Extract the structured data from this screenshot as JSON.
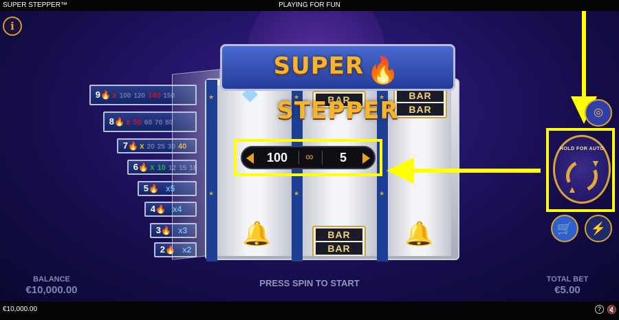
{
  "topbar": {
    "game_title": "SUPER STEPPER™",
    "mode": "PLAYING FOR FUN"
  },
  "logo": {
    "left": "SUPER",
    "right": "STEPPER"
  },
  "paytable": [
    {
      "count": "9",
      "multiplier": "x",
      "values": [
        "100",
        "120",
        "140",
        "150"
      ],
      "highlight_index": 2,
      "color": "#c0182a"
    },
    {
      "count": "8",
      "multiplier": "x",
      "values": [
        "50",
        "60",
        "70",
        "80"
      ],
      "highlight_index": 0,
      "color": "#c0182a"
    },
    {
      "count": "7",
      "multiplier": "x",
      "values": [
        "20",
        "25",
        "30",
        "40"
      ],
      "highlight_index": 3,
      "color": "#e8b020"
    },
    {
      "count": "6",
      "multiplier": "x",
      "values": [
        "10",
        "12",
        "15",
        "18"
      ],
      "highlight_index": 0,
      "color": "#28b040"
    },
    {
      "count": "5",
      "multiplier": "x5",
      "values": [],
      "color": "#5fb0ff"
    },
    {
      "count": "4",
      "multiplier": "x4",
      "values": [],
      "color": "#5fb0ff"
    },
    {
      "count": "3",
      "multiplier": "x3",
      "values": [],
      "color": "#5fb0ff"
    },
    {
      "count": "2",
      "multiplier": "x2",
      "values": [],
      "color": "#5fb0ff"
    }
  ],
  "reels": {
    "bar_text": "BAR"
  },
  "bet_selector": {
    "value_left": "100",
    "infinity": "∞",
    "value_right": "5"
  },
  "spin": {
    "hold_label": "HOLD FOR AUTO"
  },
  "bottom": {
    "balance_label": "BALANCE",
    "balance_value": "€10,000.00",
    "prompt": "PRESS SPIN TO START",
    "total_bet_label": "TOTAL BET",
    "total_bet_value": "€5.00"
  },
  "footer": {
    "balance": "€10,000.00",
    "help": "?"
  },
  "icons": {
    "info": "info-icon",
    "coins": "coins-icon",
    "spin": "autospin-icon",
    "cart": "cart-icon",
    "turbo": "lightning-icon",
    "sound": "sound-muted-icon"
  }
}
